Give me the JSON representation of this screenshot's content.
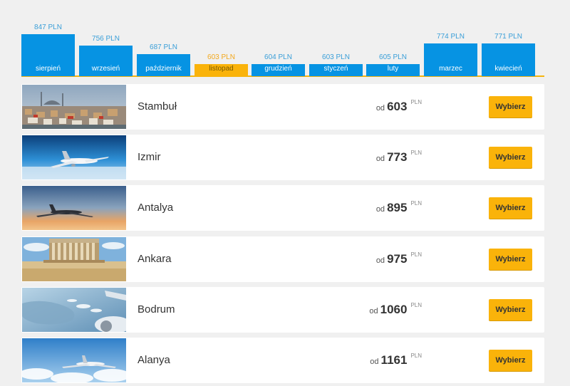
{
  "months": [
    {
      "name": "sierpień",
      "price": "847 PLN",
      "value": 847,
      "active": false
    },
    {
      "name": "wrzesień",
      "price": "756 PLN",
      "value": 756,
      "active": false
    },
    {
      "name": "październik",
      "price": "687 PLN",
      "value": 687,
      "active": false
    },
    {
      "name": "listopad",
      "price": "603 PLN",
      "value": 603,
      "active": true
    },
    {
      "name": "grudzień",
      "price": "604 PLN",
      "value": 604,
      "active": false
    },
    {
      "name": "styczeń",
      "price": "603 PLN",
      "value": 603,
      "active": false
    },
    {
      "name": "luty",
      "price": "605 PLN",
      "value": 605,
      "active": false
    },
    {
      "name": "marzec",
      "price": "774 PLN",
      "value": 774,
      "active": false
    },
    {
      "name": "kwiecień",
      "price": "771 PLN",
      "value": 771,
      "active": false
    }
  ],
  "destinations": [
    {
      "city": "Stambuł",
      "from": "od",
      "price": "603",
      "currency": "PLN",
      "button": "Wybierz"
    },
    {
      "city": "Izmir",
      "from": "od",
      "price": "773",
      "currency": "PLN",
      "button": "Wybierz"
    },
    {
      "city": "Antalya",
      "from": "od",
      "price": "895",
      "currency": "PLN",
      "button": "Wybierz"
    },
    {
      "city": "Ankara",
      "from": "od",
      "price": "975",
      "currency": "PLN",
      "button": "Wybierz"
    },
    {
      "city": "Bodrum",
      "from": "od",
      "price": "1060",
      "currency": "PLN",
      "button": "Wybierz"
    },
    {
      "city": "Alanya",
      "from": "od",
      "price": "1161",
      "currency": "PLN",
      "button": "Wybierz"
    }
  ],
  "colors": {
    "accent": "#fab30a",
    "bar": "#0693e3",
    "price_label": "#3a9fd8"
  }
}
